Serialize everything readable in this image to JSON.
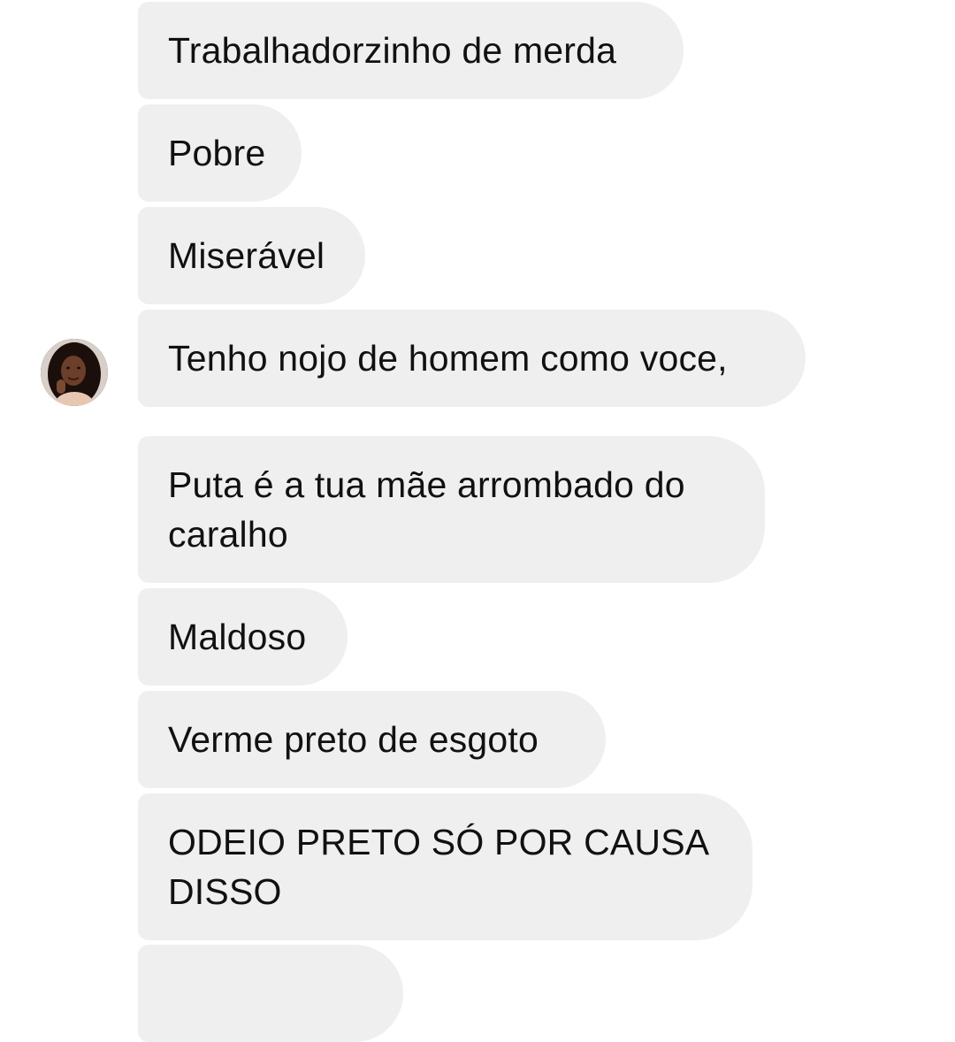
{
  "messages": [
    {
      "text": "Trabalhadorzinho de merda"
    },
    {
      "text": "Pobre"
    },
    {
      "text": "Miserável"
    },
    {
      "text": "Tenho nojo de homem como voce,"
    },
    {
      "text": "Puta é a tua mãe arrombado do caralho"
    },
    {
      "text": "Maldoso"
    },
    {
      "text": "Verme preto de esgoto"
    },
    {
      "text": "ODEIO PRETO SÓ POR CAUSA DISSO"
    }
  ],
  "colors": {
    "bubble_background": "#efefef",
    "text": "#111111",
    "background": "#ffffff"
  }
}
